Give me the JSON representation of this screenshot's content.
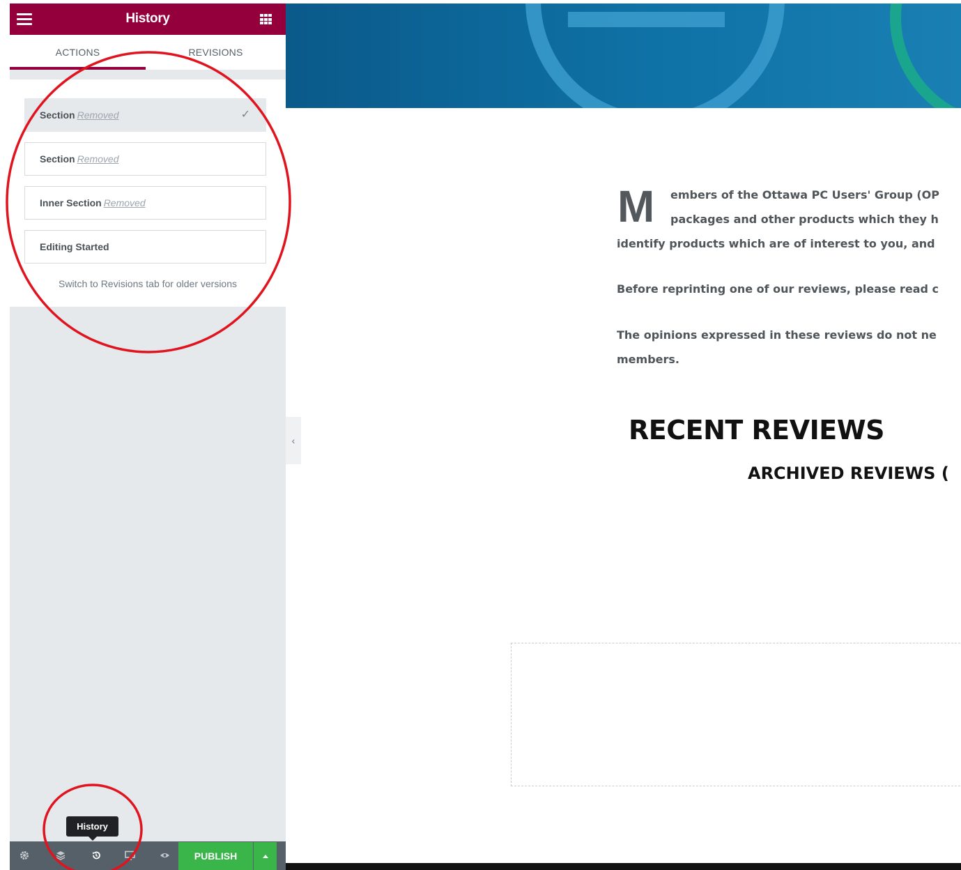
{
  "sidebar": {
    "title": "History",
    "tabs": [
      {
        "label": "ACTIONS"
      },
      {
        "label": "REVISIONS"
      }
    ],
    "items": [
      {
        "title": "Section",
        "action": "Removed"
      },
      {
        "title": "Section",
        "action": "Removed"
      },
      {
        "title": "Inner Section",
        "action": "Removed"
      },
      {
        "title": "Editing Started",
        "action": ""
      }
    ],
    "hint": "Switch to Revisions tab for older versions",
    "footer": {
      "tooltip": "History",
      "publish_label": "PUBLISH"
    }
  },
  "preview": {
    "drop_cap": "M",
    "intro_line1": "embers of the Ottawa PC Users' Group (OP",
    "intro_line2": "packages and other products which they h",
    "intro_line3": "identify products which are of interest to you, and",
    "para2": "Before reprinting one of our reviews, please read c",
    "para3_line1": "The opinions expressed in these reviews do not ne",
    "para3_line2": "members.",
    "heading_recent": "RECENT REVIEWS",
    "heading_archived": "ARCHIVED REVIEWS ("
  },
  "colors": {
    "brand": "#93003c",
    "publish": "#39b54a",
    "annotation": "#e0141e"
  },
  "icons": {
    "menu": "hamburger-icon",
    "apps": "grid-icon",
    "settings": "gear-icon",
    "navigator": "layers-icon",
    "history": "history-icon",
    "responsive": "desktop-icon",
    "preview": "eye-icon"
  }
}
